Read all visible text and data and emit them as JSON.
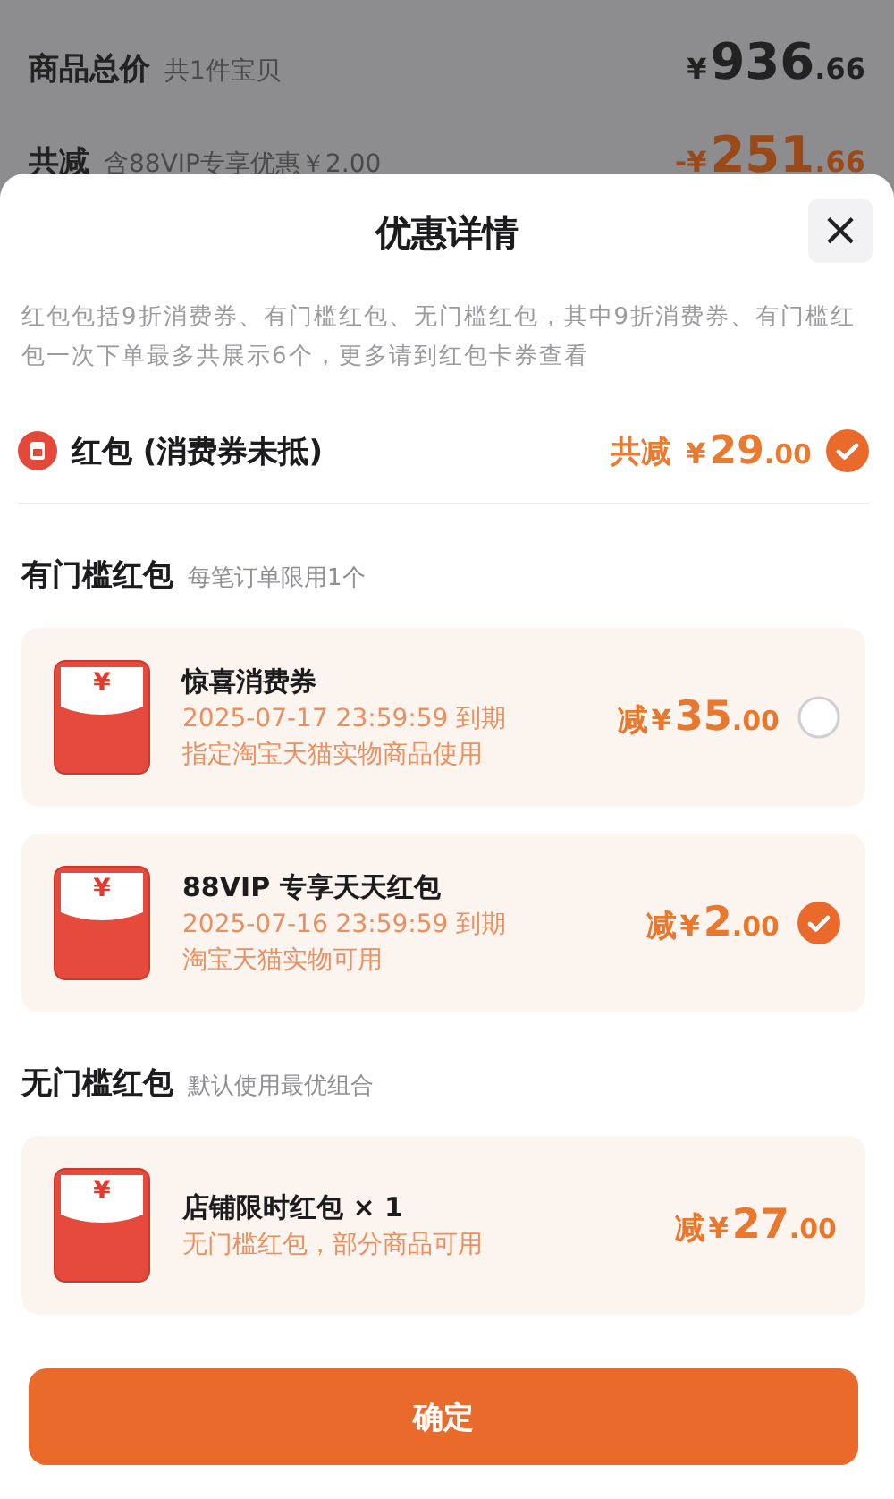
{
  "background_page": {
    "rows": [
      {
        "label": "商品总价",
        "note": "共1件宝贝",
        "amount": {
          "currency": "¥",
          "main": "936",
          "fraction": ".66"
        },
        "kind": "price"
      },
      {
        "label": "共减",
        "note": "含88VIP专享优惠￥2.00",
        "amount": {
          "currency": "-¥",
          "main": "251",
          "fraction": ".66"
        },
        "kind": "discount"
      }
    ]
  },
  "sheet": {
    "title": "优惠详情",
    "close": "×",
    "description": "红包包括9折消费券、有门槛红包、无门槛红包，其中9折消费券、有门槛红包一次下单最多共展示6个，更多请到红包卡券查看",
    "summary": {
      "label": "红包 (消费券未抵)",
      "prefix": "共减",
      "amount": {
        "currency": "¥",
        "main": "29",
        "fraction": ".00"
      },
      "selected": true
    },
    "sections": [
      {
        "title": "有门槛红包",
        "note": "每笔订单限用1个",
        "coupons": [
          {
            "kind": "radio",
            "badge": "¥",
            "name": "惊喜消费券",
            "lines": [
              "2025-07-17 23:59:59 到期",
              "指定淘宝天猫实物商品使用"
            ],
            "prefix": "减",
            "amount": {
              "currency": "¥",
              "main": "35",
              "fraction": ".00"
            },
            "selected": false
          },
          {
            "kind": "radio",
            "badge": "¥",
            "name": "88VIP 专享天天红包",
            "lines": [
              "2025-07-16 23:59:59 到期",
              "淘宝天猫实物可用"
            ],
            "prefix": "减",
            "amount": {
              "currency": "¥",
              "main": "2",
              "fraction": ".00"
            },
            "selected": true
          }
        ]
      },
      {
        "title": "无门槛红包",
        "note": "默认使用最优组合",
        "coupons": [
          {
            "kind": "plain",
            "badge": "¥",
            "name": "店铺限时红包 × 1",
            "lines": [
              "无门槛红包，部分商品可用"
            ],
            "prefix": "减",
            "amount": {
              "currency": "¥",
              "main": "27",
              "fraction": ".00"
            }
          }
        ]
      }
    ],
    "confirm": "确定"
  }
}
